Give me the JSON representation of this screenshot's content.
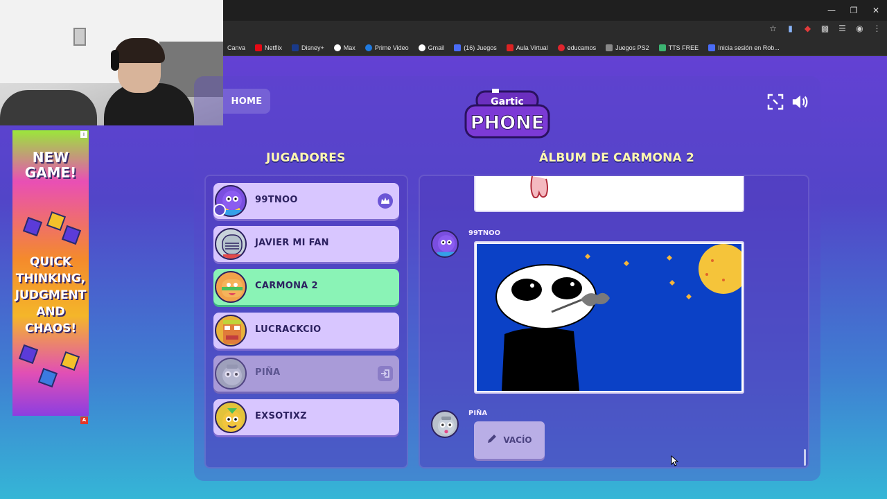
{
  "browser": {
    "bookmarks": [
      {
        "label": "Canva",
        "color": "#00c4cc"
      },
      {
        "label": "Netflix",
        "color": "#e50914"
      },
      {
        "label": "Disney+",
        "color": "#1a3a8a"
      },
      {
        "label": "Max",
        "color": "#ffffff"
      },
      {
        "label": "Prime Video",
        "color": "#1f7ae0"
      },
      {
        "label": "Gmail",
        "color": "#ffffff"
      },
      {
        "label": "(16) Juegos",
        "color": "#4a6cf7"
      },
      {
        "label": "Aula Virtual",
        "color": "#d22"
      },
      {
        "label": "educamos",
        "color": "#e0252d"
      },
      {
        "label": "Juegos PS2",
        "color": "#888888"
      },
      {
        "label": "TTS FREE",
        "color": "#3cb371"
      },
      {
        "label": "Inicia sesión en Rob...",
        "color": "#4a6cf7"
      }
    ]
  },
  "ad": {
    "headline": "NEW GAME!",
    "tagline": "QUICK THINKING, JUDGMENT AND CHAOS!"
  },
  "game": {
    "home_label": "HOME",
    "logo_top": "Gartic",
    "logo_bottom": "PHONE",
    "players_title": "JUGADORES",
    "album_title": "ÁLBUM DE CARMONA 2",
    "players": [
      {
        "name": "99TNOO",
        "avatar_color": "#7a4ee0",
        "state": "host"
      },
      {
        "name": "JAVIER MI FAN",
        "avatar_color": "#b9c6cf",
        "state": "normal"
      },
      {
        "name": "CARMONA 2",
        "avatar_color": "#f2a24b",
        "state": "active"
      },
      {
        "name": "LUCRACKCIO",
        "avatar_color": "#e8b23a",
        "state": "normal"
      },
      {
        "name": "PIÑA",
        "avatar_color": "#9aa3b0",
        "state": "left"
      },
      {
        "name": "EXSOTIXZ",
        "avatar_color": "#e3c33a",
        "state": "normal"
      }
    ],
    "album": {
      "entry_1_author": "99TNOO",
      "entry_2_author": "PIÑA",
      "empty_label": "VACÍO"
    }
  }
}
